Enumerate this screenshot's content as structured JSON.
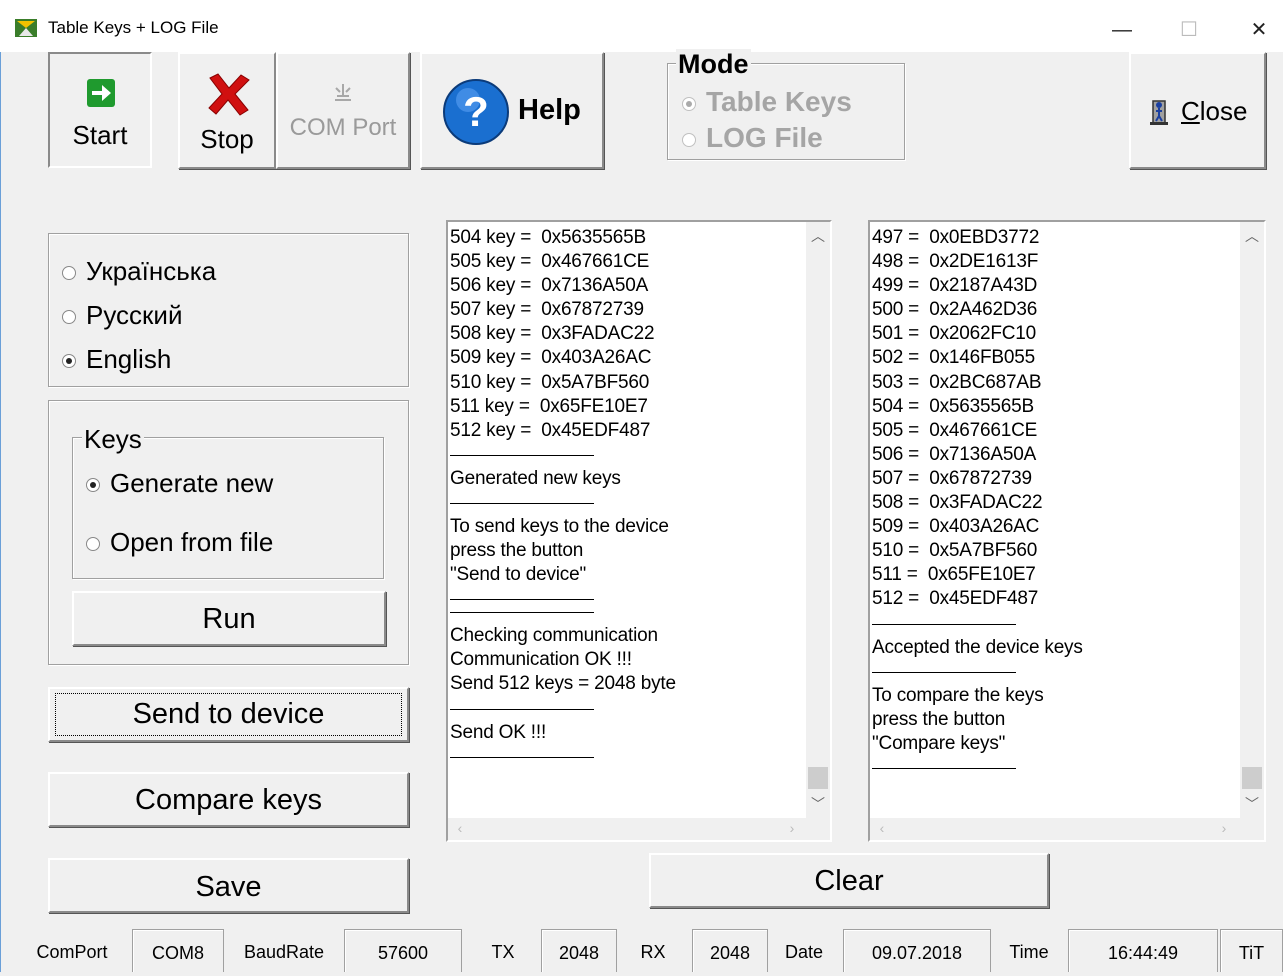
{
  "window": {
    "title": "Table Keys + LOG File",
    "minimize_icon": "minimize-icon",
    "maximize_icon": "maximize-icon",
    "close_icon": "close-icon",
    "minimize_glyph": "—",
    "maximize_glyph": "☐",
    "close_glyph": "✕"
  },
  "toolbar": {
    "start_label": "Start",
    "stop_label": "Stop",
    "comport_label": "COM Port",
    "help_label": "Help",
    "close_label": "Close",
    "close_access_key": "C",
    "close_rest": "lose"
  },
  "mode": {
    "label": "Mode",
    "options": [
      "Table Keys",
      "LOG File"
    ],
    "selected": "Table Keys"
  },
  "language": {
    "options": [
      "Українська",
      "Русский",
      "English"
    ],
    "selected": "English"
  },
  "keys": {
    "label": "Keys",
    "options": [
      "Generate new",
      "Open from file"
    ],
    "selected": "Generate new",
    "run_label": "Run"
  },
  "actions": {
    "send_label": "Send to device",
    "compare_label": "Compare keys",
    "save_label": "Save",
    "clear_label": "Clear"
  },
  "left_log": [
    "504 key =  0x5635565B",
    "505 key =  0x467661CE",
    "506 key =  0x7136A50A",
    "507 key =  0x67872739",
    "508 key =  0x3FADAC22",
    "509 key =  0x403A26AC",
    "510 key =  0x5A7BF560",
    "511 key =  0x65FE10E7",
    "512 key =  0x45EDF487",
    "---",
    "Generated new keys",
    "---",
    "To send keys to the device",
    "press the button",
    "\"Send to device\"",
    "---",
    "---",
    "Checking communication",
    "Communication OK !!!",
    "Send 512 keys = 2048 byte",
    "---",
    "Send OK !!!",
    "---"
  ],
  "right_log": [
    "497 =  0x0EBD3772",
    "498 =  0x2DE1613F",
    "499 =  0x2187A43D",
    "500 =  0x2A462D36",
    "501 =  0x2062FC10",
    "502 =  0x146FB055",
    "503 =  0x2BC687AB",
    "504 =  0x5635565B",
    "505 =  0x467661CE",
    "506 =  0x7136A50A",
    "507 =  0x67872739",
    "508 =  0x3FADAC22",
    "509 =  0x403A26AC",
    "510 =  0x5A7BF560",
    "511 =  0x65FE10E7",
    "512 =  0x45EDF487",
    "---",
    "Accepted the device keys",
    "---",
    "To compare the keys",
    "press the button",
    "\"Compare keys\"",
    "---"
  ],
  "statusbar": {
    "comport_label": "ComPort",
    "comport_value": "COM8",
    "baud_label": "BaudRate",
    "baud_value": "57600",
    "tx_label": "TX",
    "tx_value": "2048",
    "rx_label": "RX",
    "rx_value": "2048",
    "date_label": "Date",
    "date_value": "09.07.2018",
    "time_label": "Time",
    "time_value": "16:44:49",
    "tit_label": "TiT"
  },
  "colors": {
    "title_border": "#6a9fd8",
    "help_blue": "#1a6fd0",
    "stop_red": "#d01010",
    "start_green": "#1f9a2e"
  }
}
